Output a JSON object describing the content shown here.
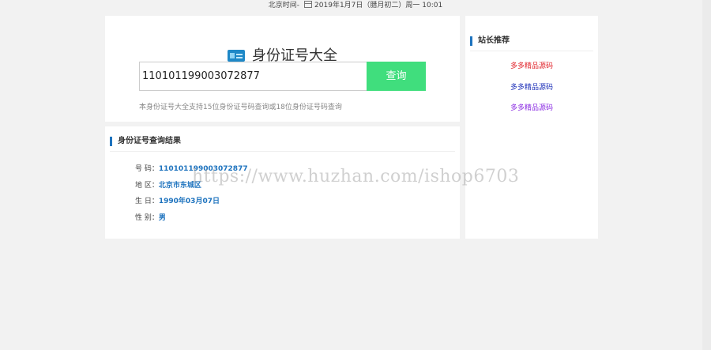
{
  "topbar": {
    "label": "北京时间-",
    "date_text": "2019年1月7日（腊月初二）周一 10:01"
  },
  "search": {
    "title": "身份证号大全",
    "input_value": "110101199003072877",
    "button_label": "查询",
    "note": "本身份证号大全支持15位身份证号码查询或18位身份证号码查询"
  },
  "result": {
    "title": "身份证号查询结果",
    "rows": [
      {
        "label": "号 码：",
        "value": "110101199003072877"
      },
      {
        "label": "地 区：",
        "value": "北京市东城区"
      },
      {
        "label": "生 日：",
        "value": "1990年03月07日"
      },
      {
        "label": "性 别：",
        "value": "男"
      }
    ]
  },
  "sidebar": {
    "title": "站长推荐",
    "links": [
      {
        "label": "多多精品源码",
        "color": "#e0232a"
      },
      {
        "label": "多多精品源码",
        "color": "#1c2fb8"
      },
      {
        "label": "多多精品源码",
        "color": "#8a2be2"
      }
    ]
  },
  "watermark": "https://www.huzhan.com/ishop6703",
  "colors": {
    "accent": "#1e73be",
    "button": "#40de7d",
    "background": "#f2f2f2"
  }
}
